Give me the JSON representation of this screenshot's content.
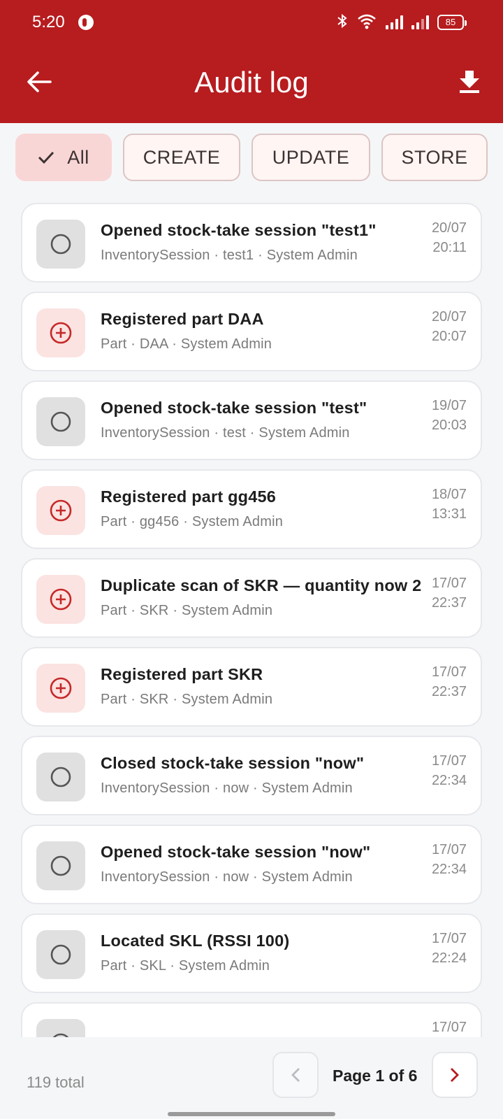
{
  "status_bar": {
    "time": "5:20",
    "battery": "85",
    "icons": [
      "bluetooth-icon",
      "wifi-icon",
      "signal-icon",
      "signal-icon",
      "battery-icon"
    ]
  },
  "app_bar": {
    "title": "Audit log",
    "back_icon": "arrow-left-icon",
    "download_icon": "download-icon",
    "color": "#b71c1f"
  },
  "filters": [
    {
      "label": "All",
      "selected": true
    },
    {
      "label": "CREATE",
      "selected": false
    },
    {
      "label": "UPDATE",
      "selected": false
    },
    {
      "label": "STORE",
      "selected": false
    }
  ],
  "entries": [
    {
      "type": "neutral",
      "title": "Opened stock-take session \"test1\"",
      "subtitle": "InventorySession · test1 · System Admin",
      "date": "20/07",
      "time": "20:11"
    },
    {
      "type": "create",
      "title": "Registered part DAA",
      "subtitle": "Part · DAA · System Admin",
      "date": "20/07",
      "time": "20:07"
    },
    {
      "type": "neutral",
      "title": "Opened stock-take session \"test\"",
      "subtitle": "InventorySession · test · System Admin",
      "date": "19/07",
      "time": "20:03"
    },
    {
      "type": "create",
      "title": "Registered part gg456",
      "subtitle": "Part · gg456 · System Admin",
      "date": "18/07",
      "time": "13:31"
    },
    {
      "type": "create",
      "title": "Duplicate scan of SKR — quantity now 2",
      "subtitle": "Part · SKR · System Admin",
      "date": "17/07",
      "time": "22:37"
    },
    {
      "type": "create",
      "title": "Registered part SKR",
      "subtitle": "Part · SKR · System Admin",
      "date": "17/07",
      "time": "22:37"
    },
    {
      "type": "neutral",
      "title": "Closed stock-take session \"now\"",
      "subtitle": "InventorySession · now · System Admin",
      "date": "17/07",
      "time": "22:34"
    },
    {
      "type": "neutral",
      "title": "Opened stock-take session \"now\"",
      "subtitle": "InventorySession · now · System Admin",
      "date": "17/07",
      "time": "22:34"
    },
    {
      "type": "neutral",
      "title": "Located SKL (RSSI 100)",
      "subtitle": "Part · SKL · System Admin",
      "date": "17/07",
      "time": "22:24"
    },
    {
      "type": "neutral",
      "title": "",
      "subtitle": "",
      "date": "17/07",
      "time": ""
    }
  ],
  "footer": {
    "total": "119 total",
    "page_label": "Page 1 of 6"
  }
}
